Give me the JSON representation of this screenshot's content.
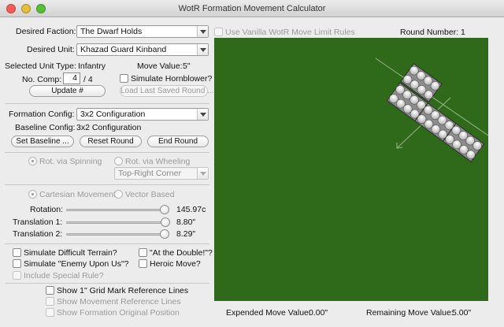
{
  "window": {
    "title": "WotR Formation Movement Calculator"
  },
  "faction": {
    "label": "Desired Faction:",
    "value": "The Dwarf Holds"
  },
  "unit": {
    "label": "Desired Unit:",
    "value": "Khazad Guard Kinband"
  },
  "unit_info": {
    "type_label": "Selected Unit Type:",
    "type_value": "Infantry",
    "move_label": "Move Value:",
    "move_value": "5\""
  },
  "companies": {
    "label": "No. Comp:",
    "value": "4",
    "of_total": "/ 4"
  },
  "hornblower": {
    "label": "Simulate Hornblower?",
    "checked": false
  },
  "buttons": {
    "update": "Update #",
    "load_last": "Load Last Saved Round ...",
    "set_baseline": "Set Baseline ...",
    "reset_round": "Reset Round",
    "end_round": "End Round"
  },
  "formation": {
    "config_label": "Formation Config:",
    "config_value": "3x2 Configuration",
    "baseline_label": "Baseline Config:",
    "baseline_value": "3x2 Configuration"
  },
  "rotation_mode": {
    "spinning": "Rot. via Spinning",
    "wheeling": "Rot. via Wheeling",
    "corner_value": "Top-Right Corner",
    "selected": "spinning"
  },
  "movement_mode": {
    "cartesian": "Cartesian Movement",
    "vector": "Vector Based",
    "selected": "cartesian"
  },
  "sliders": {
    "rotation": {
      "label": "Rotation:",
      "value": "145.97c",
      "fraction": 0.96
    },
    "translation1": {
      "label": "Translation 1:",
      "value": "8.80\"",
      "fraction": 0.97
    },
    "translation2": {
      "label": "Translation 2:",
      "value": "8.29\"",
      "fraction": 0.96
    }
  },
  "options": {
    "difficult_terrain": "Simulate Difficult Terrain?",
    "at_the_double": "\"At the Double!\"?",
    "enemy_upon_us": "Simulate \"Enemy Upon Us\"?",
    "heroic_move": "Heroic Move?",
    "special_rule": "Include Special Rule?"
  },
  "display": {
    "grid_lines": "Show 1\" Grid Mark Reference Lines",
    "movement_lines": "Show Movement Reference Lines",
    "original_position": "Show Formation Original Position"
  },
  "board": {
    "vanilla_label": "Use Vanilla WotR Move Limit Rules",
    "round_label": "Round Number:",
    "round_value": "1",
    "expended_label": "Expended Move Value:",
    "expended_value": "0.00\"",
    "remaining_label": "Remaining Move Value:",
    "remaining_value": "5.00\""
  },
  "colors": {
    "board": "#2f6a1b",
    "close": "#fc5b57",
    "minimize": "#e5bf3c",
    "zoom": "#57c038"
  }
}
